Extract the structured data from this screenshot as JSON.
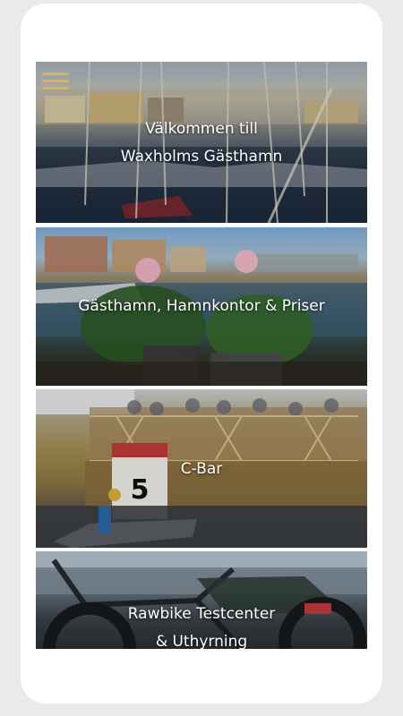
{
  "menu": {
    "icon": "hamburger-menu-icon"
  },
  "tiles": [
    {
      "line1": "Välkommen till",
      "line2": "Waxholms Gästhamn"
    },
    {
      "line1": "Gästhamn, Hamnkontor & Priser"
    },
    {
      "line1": "C-Bar"
    },
    {
      "line1": "Rawbike Testcenter",
      "line2": "& Uthyrning"
    }
  ],
  "colors": {
    "menu_icon": "#e2b24a",
    "label_text": "#ffffff",
    "frame": "#ffffff",
    "background": "#e8eaeb"
  }
}
